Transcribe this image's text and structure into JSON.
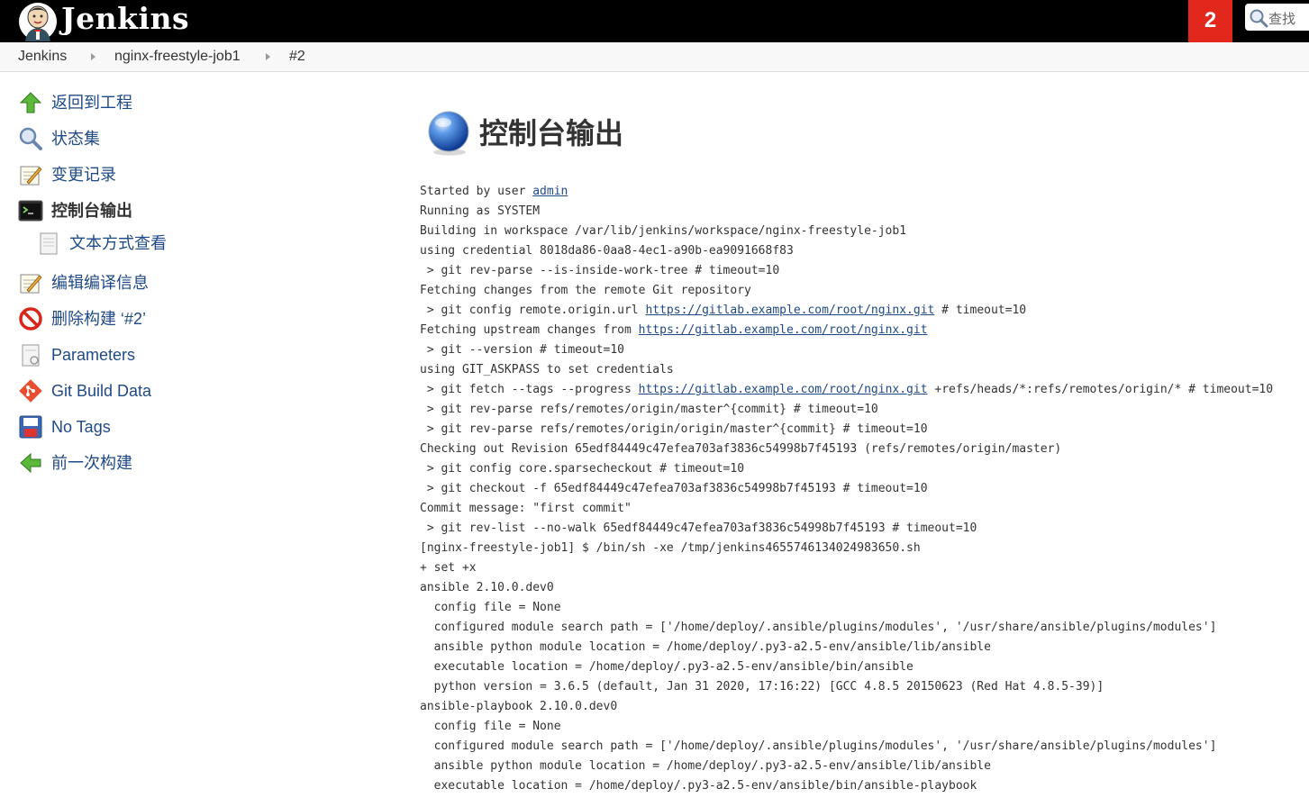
{
  "header": {
    "logo_text": "Jenkins",
    "notification_count": "2",
    "search_placeholder": "查找"
  },
  "breadcrumb": [
    "Jenkins",
    "nginx-freestyle-job1",
    "#2"
  ],
  "sidebar": {
    "items": [
      {
        "label": "返回到工程",
        "icon": "up-arrow-icon"
      },
      {
        "label": "状态集",
        "icon": "magnifier-icon"
      },
      {
        "label": "变更记录",
        "icon": "notepad-icon"
      },
      {
        "label": "控制台输出",
        "icon": "terminal-icon",
        "active": true
      },
      {
        "label": "文本方式查看",
        "icon": "document-icon",
        "sub": true
      },
      {
        "label": "编辑编译信息",
        "icon": "notepad-icon"
      },
      {
        "label": "删除构建 ‘#2’",
        "icon": "no-entry-icon"
      },
      {
        "label": "Parameters",
        "icon": "document-icon"
      },
      {
        "label": "Git Build Data",
        "icon": "git-icon"
      },
      {
        "label": "No Tags",
        "icon": "save-disk-icon"
      },
      {
        "label": "前一次构建",
        "icon": "left-arrow-icon"
      }
    ]
  },
  "main": {
    "title": "控制台输出",
    "console": [
      [
        "Started by user ",
        {
          "link": "admin"
        }
      ],
      [
        "Running as SYSTEM"
      ],
      [
        "Building in workspace /var/lib/jenkins/workspace/nginx-freestyle-job1"
      ],
      [
        "using credential 8018da86-0aa8-4ec1-a90b-ea9091668f83"
      ],
      [
        " > git rev-parse --is-inside-work-tree # timeout=10"
      ],
      [
        "Fetching changes from the remote Git repository"
      ],
      [
        " > git config remote.origin.url ",
        {
          "link": "https://gitlab.example.com/root/nginx.git"
        },
        " # timeout=10"
      ],
      [
        "Fetching upstream changes from ",
        {
          "link": "https://gitlab.example.com/root/nginx.git"
        }
      ],
      [
        " > git --version # timeout=10"
      ],
      [
        "using GIT_ASKPASS to set credentials"
      ],
      [
        " > git fetch --tags --progress ",
        {
          "link": "https://gitlab.example.com/root/nginx.git"
        },
        " +refs/heads/*:refs/remotes/origin/* # timeout=10"
      ],
      [
        " > git rev-parse refs/remotes/origin/master^{commit} # timeout=10"
      ],
      [
        " > git rev-parse refs/remotes/origin/origin/master^{commit} # timeout=10"
      ],
      [
        "Checking out Revision 65edf84449c47efea703af3836c54998b7f45193 (refs/remotes/origin/master)"
      ],
      [
        " > git config core.sparsecheckout # timeout=10"
      ],
      [
        " > git checkout -f 65edf84449c47efea703af3836c54998b7f45193 # timeout=10"
      ],
      [
        "Commit message: \"first commit\""
      ],
      [
        " > git rev-list --no-walk 65edf84449c47efea703af3836c54998b7f45193 # timeout=10"
      ],
      [
        "[nginx-freestyle-job1] $ /bin/sh -xe /tmp/jenkins4655746134024983650.sh"
      ],
      [
        "+ set +x"
      ],
      [
        "ansible 2.10.0.dev0"
      ],
      [
        "  config file = None"
      ],
      [
        "  configured module search path = ['/home/deploy/.ansible/plugins/modules', '/usr/share/ansible/plugins/modules']"
      ],
      [
        "  ansible python module location = /home/deploy/.py3-a2.5-env/ansible/lib/ansible"
      ],
      [
        "  executable location = /home/deploy/.py3-a2.5-env/ansible/bin/ansible"
      ],
      [
        "  python version = 3.6.5 (default, Jan 31 2020, 17:16:22) [GCC 4.8.5 20150623 (Red Hat 4.8.5-39)]"
      ],
      [
        "ansible-playbook 2.10.0.dev0"
      ],
      [
        "  config file = None"
      ],
      [
        "  configured module search path = ['/home/deploy/.ansible/plugins/modules', '/usr/share/ansible/plugins/modules']"
      ],
      [
        "  ansible python module location = /home/deploy/.py3-a2.5-env/ansible/lib/ansible"
      ],
      [
        "  executable location = /home/deploy/.py3-a2.5-env/ansible/bin/ansible-playbook"
      ]
    ]
  },
  "colors": {
    "header_bg": "#000000",
    "badge_bg": "#e2281c",
    "link": "#204a87",
    "breadcrumb_bg": "#f8f8f8"
  }
}
